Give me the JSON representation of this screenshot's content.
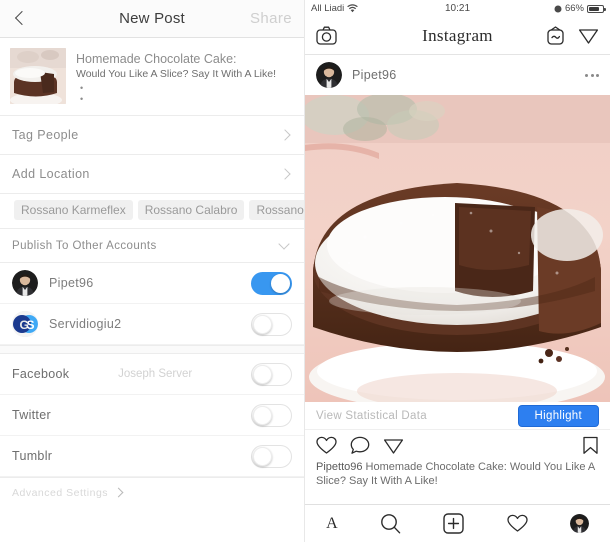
{
  "left_panel": {
    "header": {
      "back_icon": "back-chevron-icon",
      "title": "New Post",
      "share_label": "Share"
    },
    "caption": {
      "line1": "Homemade Chocolate Cake:",
      "line2": "Would You Like A Slice? Say It With A Like!",
      "bullet1": "•",
      "bullet2": "•"
    },
    "rows": [
      {
        "label": "Tag People"
      },
      {
        "label": "Add Location"
      }
    ],
    "location_chips": [
      "Rossano Karmeflex",
      "Rossano Calabro",
      "Rossano Si"
    ],
    "publish_section": {
      "title": "Publish To Other Accounts"
    },
    "accounts": [
      {
        "name": "Pipet96",
        "avatar": "user-photo-avatar",
        "toggle": "on"
      },
      {
        "name": "Servidiogiu2",
        "avatar": "gs-logo-avatar",
        "toggle": "off"
      }
    ],
    "services": [
      {
        "name": "Facebook",
        "sub": "Joseph Server",
        "toggle": "off"
      },
      {
        "name": "Twitter",
        "sub": "",
        "toggle": "off"
      },
      {
        "name": "Tumblr",
        "sub": "",
        "toggle": "off"
      }
    ],
    "advanced": {
      "label": "Advanced Settings"
    }
  },
  "right_panel": {
    "status_bar": {
      "carrier": "All Liadi",
      "wifi_icon": "wifi-icon",
      "time": "10:21",
      "battery_percent": "66%",
      "battery_icon": "battery-icon"
    },
    "ig_header": {
      "camera_icon": "camera-icon",
      "logo": "Instagram",
      "igtv_icon": "igtv-icon",
      "direct_icon": "paper-plane-icon"
    },
    "post": {
      "username": "Pipet96",
      "avatar": "user-photo-avatar",
      "more_icon": "more-dots-icon",
      "photo_alt": "chocolate-cake-photo"
    },
    "insights": {
      "label": "View Statistical Data",
      "highlight_label": "Highlight",
      "highlight_color": "#2d7ff0"
    },
    "actions": {
      "like_icon": "heart-icon",
      "comment_icon": "comment-bubble-icon",
      "share_icon": "paper-plane-icon",
      "save_icon": "bookmark-icon"
    },
    "caption": {
      "username": "Pipetto96",
      "text": " Homemade Chocolate Cake: Would You Like A Slice? Say It With A Like!"
    },
    "tabbar": [
      {
        "name": "home",
        "glyph": "A"
      },
      {
        "name": "search",
        "glyph": ""
      },
      {
        "name": "add",
        "glyph": ""
      },
      {
        "name": "activity",
        "glyph": ""
      },
      {
        "name": "profile",
        "glyph": ""
      }
    ]
  }
}
